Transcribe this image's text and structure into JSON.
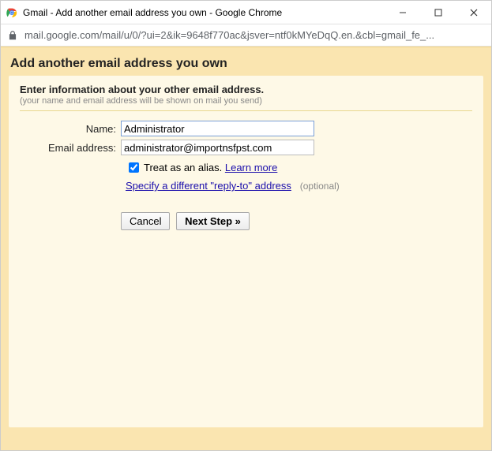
{
  "window": {
    "title": "Gmail - Add another email address you own - Google Chrome"
  },
  "address_bar": {
    "url": "mail.google.com/mail/u/0/?ui=2&ik=9648f770ac&jsver=ntf0kMYeDqQ.en.&cbl=gmail_fe_..."
  },
  "page": {
    "header": "Add another email address you own",
    "intro_bold": "Enter information about your other email address.",
    "intro_sub": "(your name and email address will be shown on mail you send)",
    "name_label": "Name:",
    "name_value": "Administrator",
    "email_label": "Email address:",
    "email_value": "administrator@importnsfpst.com",
    "alias_label": "Treat as an alias.",
    "learn_more": "Learn more",
    "reply_to_link": "Specify a different \"reply-to\" address",
    "optional_text": "(optional)",
    "cancel": "Cancel",
    "next": "Next Step »"
  }
}
